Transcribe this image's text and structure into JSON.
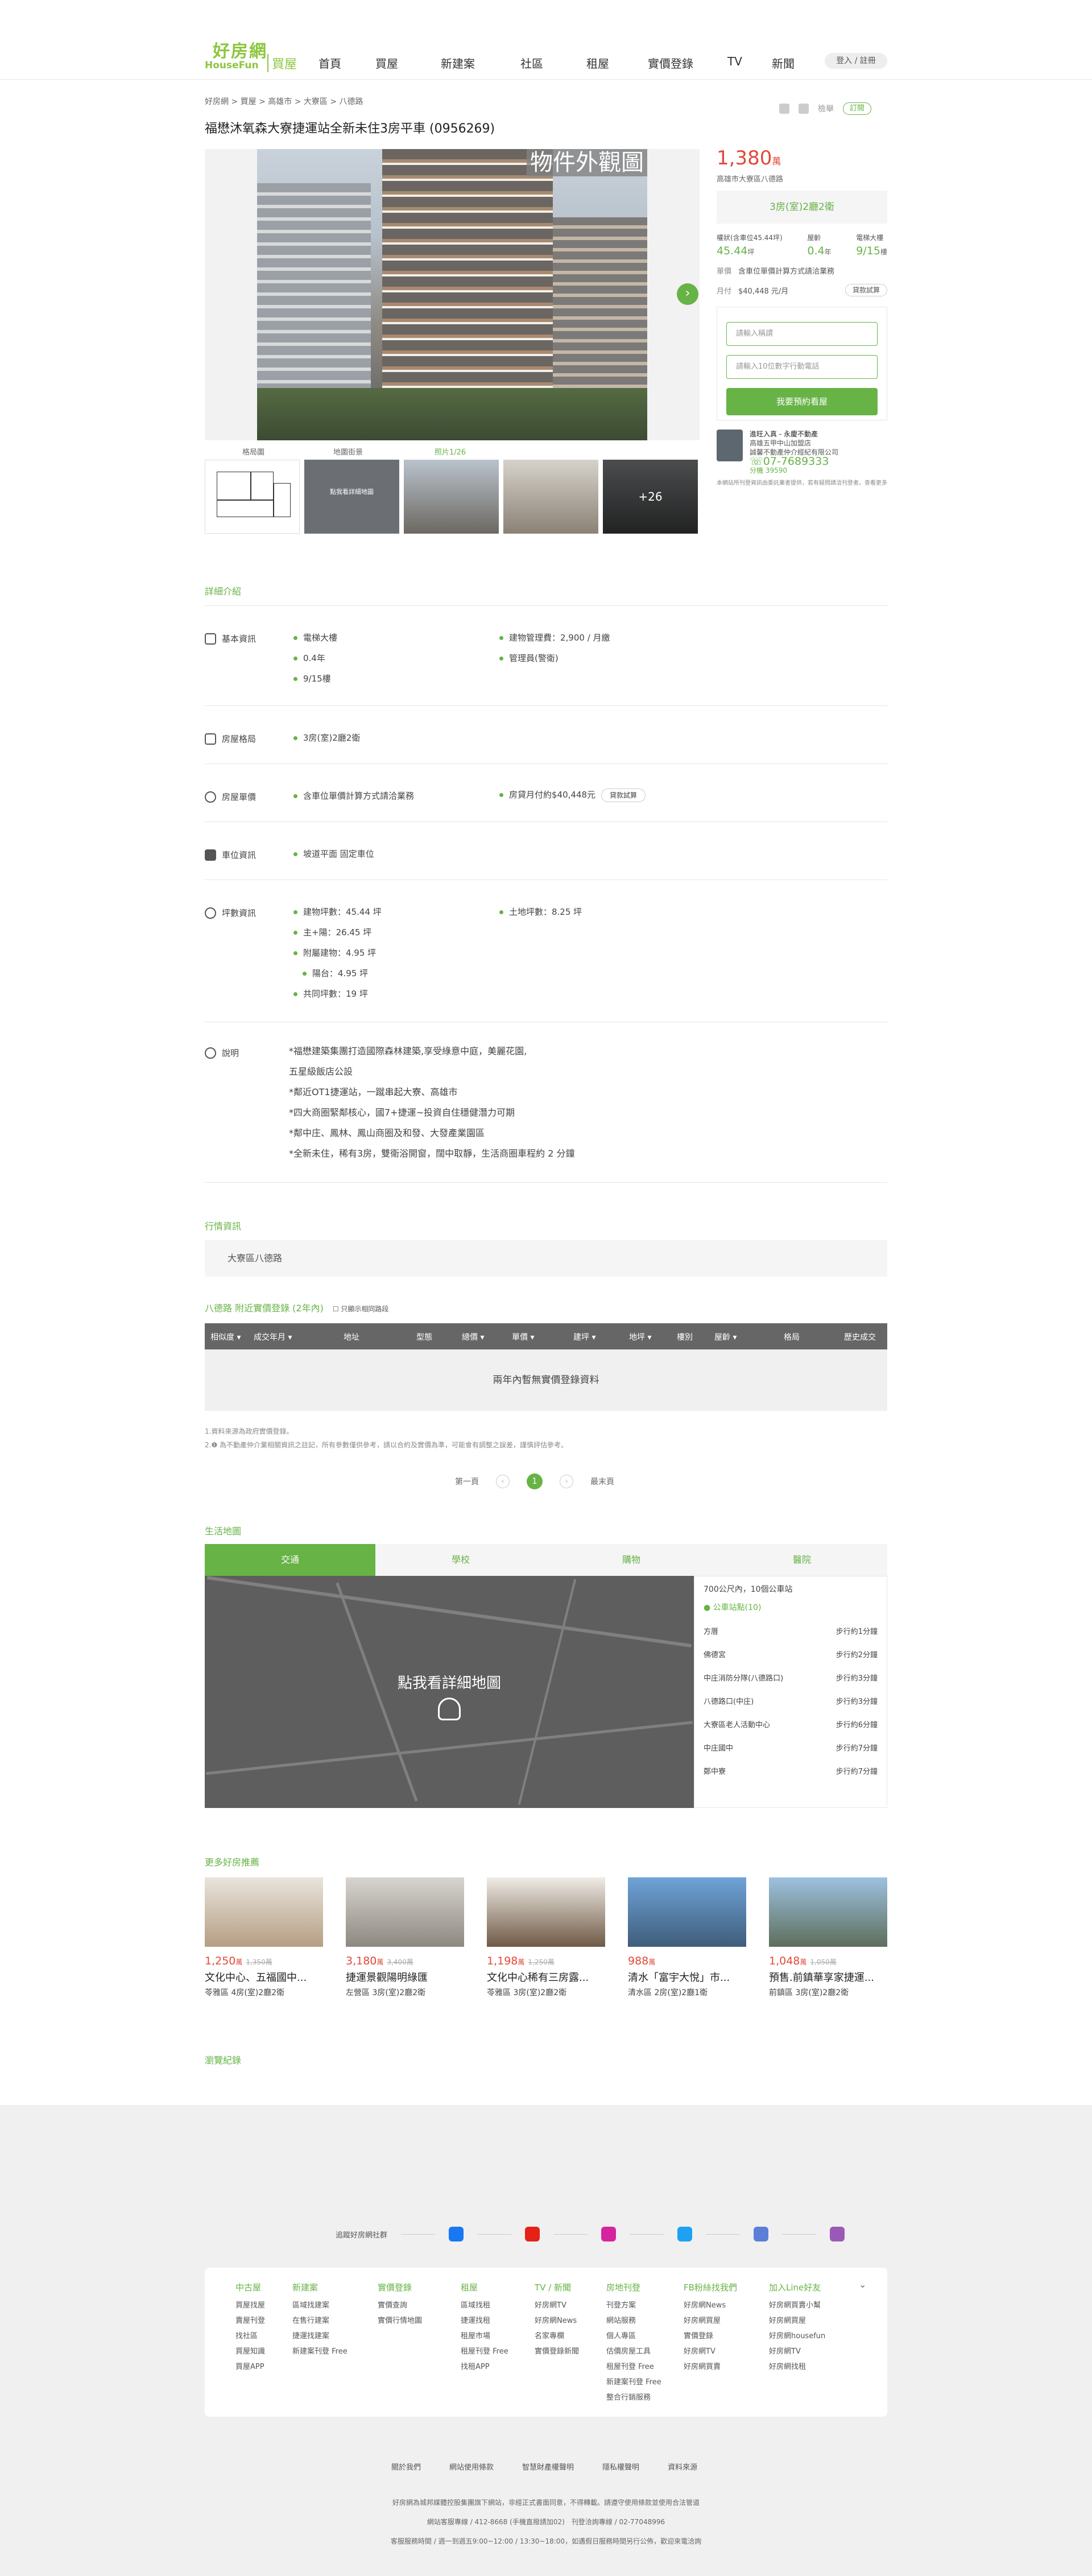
{
  "header": {
    "logo_cn": "好房網",
    "logo_en": "HouseFun",
    "logo_sub": "買屋",
    "nav": [
      "首頁",
      "買屋",
      "新建案",
      "社區",
      "租屋",
      "實價登錄",
      "TV",
      "新聞"
    ],
    "login": "登入 / 註冊"
  },
  "breadcrumb": "好房網 > 買屋 > 高雄市 > 大寮區 > 八德路",
  "share": {
    "label": "檢舉",
    "follow": "訂閱"
  },
  "listing": {
    "title": "福懋沐氧森大寮捷運站全新未住3房平車 (0956269)",
    "photo_tag": "物件外觀圖",
    "thumb_labels": [
      "格局圖",
      "地圖街景",
      "照片1/26"
    ],
    "more": "+26",
    "map_thumb": "點我看詳細地圖"
  },
  "side": {
    "price": "1,380",
    "price_unit": "萬",
    "address": "高雄市大寮區八德路",
    "layout": "3房(室)2廳2衛",
    "stats": [
      {
        "k": "權狀(含車位45.44坪)",
        "v": "45.44",
        "u": "坪"
      },
      {
        "k": "屋齡",
        "v": "0.4",
        "u": "年"
      },
      {
        "k": "電梯大樓",
        "v": "9/15",
        "u": "樓"
      }
    ],
    "unit_label": "單價",
    "unit_text": "含車位單價計算方式請洽業務",
    "monthly_label": "月付",
    "monthly_text": "$40,448 元/月",
    "calc": "貸款試算",
    "name_ph": "請輸入稱謂",
    "phone_ph": "請輸入10位數字行動電話",
    "submit": "我要預約看屋",
    "agent_name": "進旺入真 - 永慶不動產",
    "agent_co": "高雄五甲中山加盟店",
    "agent_firm": "誠馨不動產仲介經紀有限公司",
    "phone": "07-7689333",
    "ext": "分機 39590",
    "note": "本網站所刊登資訊由委託業者提供，若有疑問請洽刊登者。查看更多"
  },
  "detail": {
    "section": "詳細介紹",
    "basic_label": "基本資訊",
    "basic_left": [
      "電梯大樓",
      "0.4年",
      "9/15樓"
    ],
    "basic_right": [
      "建物管理費：2,900 / 月繳",
      "管理員(警衛)"
    ],
    "layout_label": "房屋格局",
    "layout_val": "3房(室)2廳2衛",
    "price_label": "房屋單價",
    "price_val": "含車位單價計算方式請洽業務",
    "monthly": "房貸月付約$40,448元",
    "calc": "貸款試算",
    "car_label": "車位資訊",
    "car_val": "坡道平面 固定車位",
    "area_label": "坪數資訊",
    "area_left": [
      "建物坪數：45.44 坪",
      "主+陽：26.45 坪",
      "附屬建物：4.95 坪",
      "陽台：4.95 坪",
      "共同坪數：19 坪"
    ],
    "area_right": [
      "土地坪數：8.25 坪"
    ],
    "desc_label": "說明",
    "desc": [
      "*福懋建築集團打造國際森林建築,享受綠意中庭，美麗花園,",
      "五星級飯店公設",
      "*鄰近OT1捷運站，一蹴串起大寮、高雄市",
      "*四大商圈緊鄰核心，國7+捷運~投資自住穩健潛力可期",
      "*鄰中庄、鳳林、鳳山商圈及和發、大發產業園區",
      "*全新未住，稀有3房，雙衛浴開窗，闊中取靜，生活商圈車程約 2 分鐘"
    ]
  },
  "market": {
    "section": "行情資訊",
    "area": "大寮區八德路",
    "table_title": "八德路 附近實價登錄 (2年內)",
    "toggle": "只顯示相同路段",
    "cols": [
      "相似度 ▾",
      "成交年月 ▾",
      "地址",
      "型態",
      "總價 ▾",
      "單價 ▾",
      "建坪 ▾",
      "地坪 ▾",
      "樓別",
      "屋齡 ▾",
      "格局",
      "歷史成交"
    ],
    "empty": "兩年內暫無實價登錄資料",
    "notes": [
      "1.資料來源為政府實價登錄。",
      "2.❶ 為不動產仲介業相關資訊之註記，所有參數僅供參考，請以合約及實價為準，可能會有調整之誤差，謹慎評估參考。"
    ],
    "pager": [
      "第一頁",
      "1",
      "最末頁"
    ]
  },
  "life": {
    "section": "生活地圖",
    "tabs": [
      "交通",
      "學校",
      "購物",
      "醫院"
    ],
    "map_text": "點我看詳細地圖",
    "poi_head": "700公尺內，10個公車站",
    "poi_cat": "● 公車站點(10)",
    "poi": [
      [
        "方厝",
        "步行約1分鐘"
      ],
      [
        "佛德宮",
        "步行約2分鐘"
      ],
      [
        "中庄消防分隊(八德路口)",
        "步行約3分鐘"
      ],
      [
        "八德路口(中庄)",
        "步行約3分鐘"
      ],
      [
        "大寮區老人活動中心",
        "步行約6分鐘"
      ],
      [
        "中庄國中",
        "步行約7分鐘"
      ],
      [
        "鄭中寮",
        "步行約7分鐘"
      ]
    ]
  },
  "reco": {
    "section": "更多好房推薦",
    "items": [
      {
        "price": "1,250",
        "old": "1,350萬",
        "name": "文化中心、五福國中...",
        "sub": "苓雅區 4房(室)2廳2衛"
      },
      {
        "price": "3,180",
        "old": "3,400萬",
        "name": "捷運景觀陽明綠匯",
        "sub": "左營區 3房(室)2廳2衛"
      },
      {
        "price": "1,198",
        "old": "1,250萬",
        "name": "文化中心稀有三房露...",
        "sub": "苓雅區 3房(室)2廳2衛"
      },
      {
        "price": "988",
        "old": "",
        "name": "清水「富宇大悅」市...",
        "sub": "清水區 2房(室)2廳1衛"
      },
      {
        "price": "1,048",
        "old": "1,050萬",
        "name": "預售.前鎮華享家捷運...",
        "sub": "前鎮區 3房(室)2廳2衛"
      }
    ],
    "recent": "瀏覽紀錄"
  },
  "footer": {
    "social_label": "追蹤好房網社群",
    "cols": [
      {
        "h": "中古屋",
        "items": [
          "買屋找屋",
          "賣屋刊登",
          "找社區",
          "買屋知識",
          "買屋APP"
        ]
      },
      {
        "h": "新建案",
        "items": [
          "區域找建案",
          "在售行建案",
          "捷運找建案",
          "新建案刊登 Free"
        ]
      },
      {
        "h": "實價登錄",
        "items": [
          "實價查詢",
          "實價行情地圖"
        ]
      },
      {
        "h": "租屋",
        "items": [
          "區域找租",
          "捷運找租",
          "租屋市場",
          "租屋刊登 Free",
          "找租APP"
        ]
      },
      {
        "h": "TV / 新聞",
        "items": [
          "好房網TV",
          "好房網News",
          "名家專欄",
          "實價登錄新聞"
        ]
      },
      {
        "h": "房地刊登",
        "items": [
          "刊登方案",
          "網站服務",
          "個人專區",
          "估價房屋工具",
          "租屋刊登 Free",
          "新建案刊登 Free",
          "整合行銷服務"
        ]
      },
      {
        "h": "FB粉絲找我們",
        "items": [
          "好房網News",
          "好房網買屋",
          "實價登錄",
          "好房網TV",
          "好房網買賣"
        ]
      },
      {
        "h": "加入Line好友",
        "items": [
          "好房網買賣小幫",
          "好房網買屋",
          "好房網housefun",
          "好房網TV",
          "好房網找租"
        ]
      }
    ],
    "links": [
      "關於我們",
      "網站使用條款",
      "智慧財產權聲明",
      "隱私權聲明",
      "資料來源"
    ],
    "copy": [
      "好房網為城邦媒體控股集團旗下網站，非經正式書面同意，不得轉載。請遵守使用條款並使用合法管道",
      "網站客服專線 / 412-8668 (手機直撥請加02)　刊登洽詢專線 / 02-77048996",
      "客服服務時間 / 週一到週五9:00~12:00 / 13:30~18:00，如遇假日服務時間另行公佈，歡迎來電洽詢"
    ]
  }
}
